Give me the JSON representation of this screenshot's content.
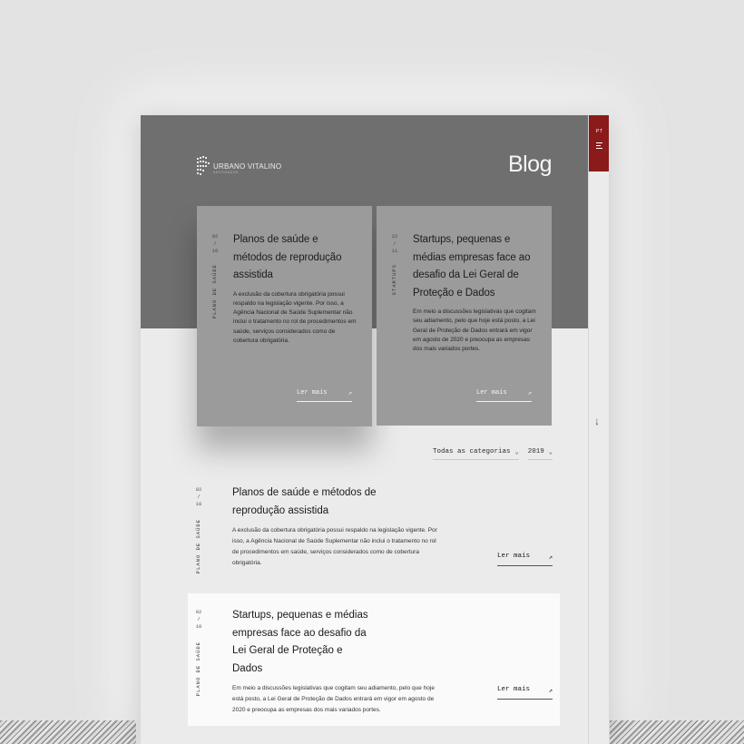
{
  "header": {
    "logo_name": "URBANO VITALINO",
    "logo_sub": "ADVOGADOS",
    "title": "Blog"
  },
  "rail": {
    "lang": "PT",
    "menu_icon": "hamburger-icon",
    "scroll_icon": "arrow-down-icon",
    "scroll_glyph": "↓"
  },
  "featured": [
    {
      "day": "02",
      "sep": "/",
      "month": "10",
      "category": "PLANO DE SAÚDE",
      "title": "Planos de saúde e métodos de reprodução assistida",
      "excerpt": "A exclusão da cobertura obrigatória possui respaldo na legislação vigente. Por isso, a Agência Nacional de Saúde Suplementar não inclui o tratamento no rol de procedimentos em saúde, serviços considerados como de cobertura obrigatória.",
      "more": "Ler mais",
      "more_icon": "↗"
    },
    {
      "day": "22",
      "sep": "/",
      "month": "11",
      "category": "STARTUPS",
      "title": "Startups, pequenas e médias empresas face ao desafio da Lei Geral de Proteção e Dados",
      "excerpt": "Em meio a discussões legislativas que cogitam seu adiamento, pelo que hoje está posto, a Lei Geral de Proteção de Dados entrará em vigor em agosto de 2020 e preocupa as empresas dos mais variados portes.",
      "more": "Ler mais",
      "more_icon": "↗"
    }
  ],
  "filters": {
    "category": "Todas as categorias",
    "year": "2019",
    "chevron": "⌄"
  },
  "posts": [
    {
      "day": "02",
      "sep": "/",
      "month": "10",
      "category": "PLANO DE SAÚDE",
      "title": "Planos de saúde e métodos de reprodução assistida",
      "excerpt": "A exclusão da cobertura obrigatória possui respaldo na legislação vigente. Por isso, a Agência Nacional de Saúde Suplementar não inclui o tratamento no rol de procedimentos em saúde, serviços considerados como de cobertura obrigatória.",
      "more": "Ler mais",
      "more_icon": "↗"
    },
    {
      "day": "02",
      "sep": "/",
      "month": "10",
      "category": "PLANO DE SAÚDE",
      "title": "Startups, pequenas e médias empresas face ao desafio da Lei Geral de Proteção e Dados",
      "excerpt": "Em meio a discussões legislativas que cogitam seu adiamento, pelo que hoje está posto, a Lei Geral de Proteção de Dados entrará em vigor em agosto de 2020 e preocupa as empresas dos mais variados portes.",
      "more": "Ler mais",
      "more_icon": "↗"
    }
  ],
  "colors": {
    "accent": "#8b1a1a",
    "hero": "#6f6f6f",
    "card": "#9b9b9b",
    "page": "#ebebeb"
  }
}
